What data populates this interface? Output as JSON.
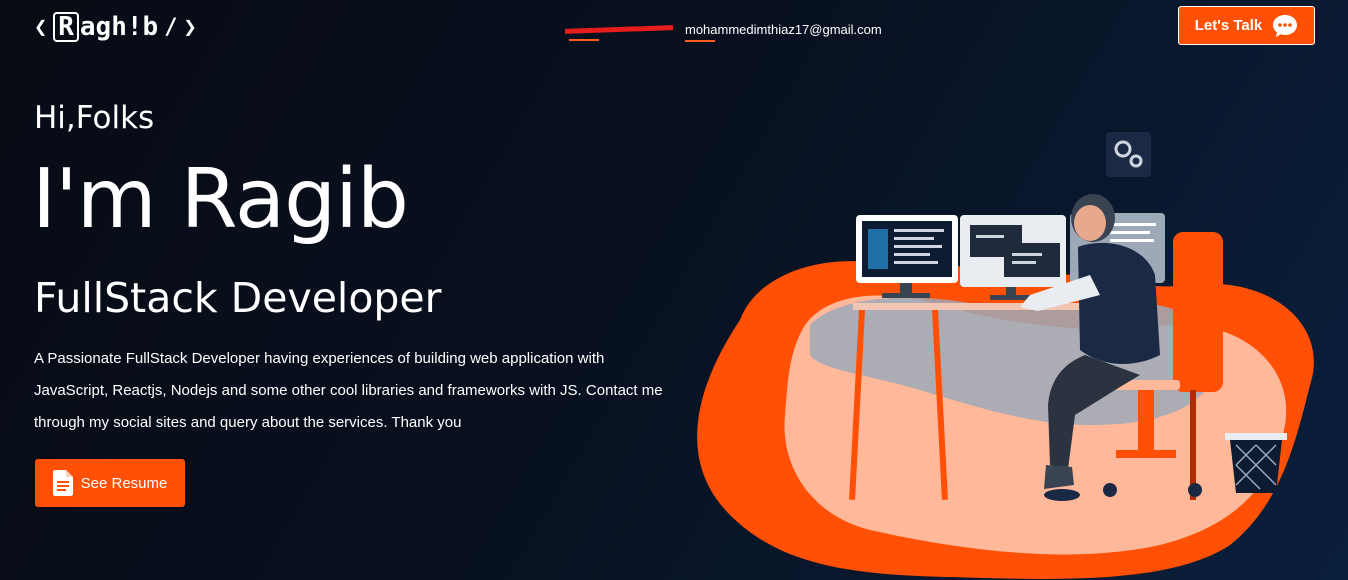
{
  "header": {
    "logo": {
      "left_bracket": "❮",
      "r_letter": "R",
      "rest": "agh!b",
      "slash": "/",
      "right_bracket": "❯"
    },
    "phone_redacted": "",
    "email": "mohammedimthiaz17@gmail.com",
    "talk_button": {
      "label": "Let's Talk",
      "icon": "chat-bubble-icon"
    }
  },
  "hero": {
    "greeting": "Hi,Folks",
    "name": "I'm Ragib",
    "role": "FullStack Developer",
    "description": "A Passionate FullStack Developer having experiences of building web application with JavaScript, Reactjs, Nodejs and some other cool libraries and frameworks with JS. Contact me through my social sites and query about the services. Thank you",
    "resume_button": {
      "label": "See Resume",
      "icon": "document-icon"
    }
  },
  "colors": {
    "accent": "#ff5005",
    "background": "#070b14",
    "illustration_peach": "#ffb899",
    "illustration_grey": "#9ea9b8"
  }
}
